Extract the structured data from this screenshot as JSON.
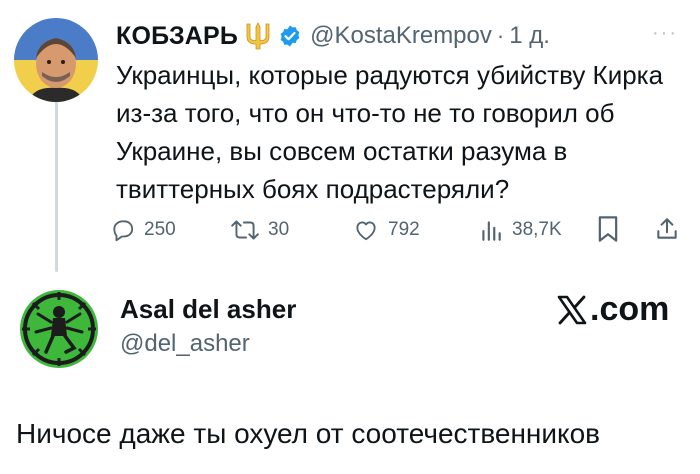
{
  "tweet": {
    "author_name": "КОБЗАРЬ",
    "handle": "@KostaKrempov",
    "separator": "·",
    "time": "1 д.",
    "more": "···",
    "text": "Украинцы, которые радуются убийству Кирка из-за того, что он что-то не то говорил об Украине, вы совсем остатки разума в твиттерных боях подрастеряли?",
    "stats": {
      "replies": "250",
      "retweets": "30",
      "likes": "792",
      "views": "38,7K"
    },
    "icons": [
      "trident-emoji",
      "verified-badge",
      "reply-icon",
      "retweet-icon",
      "like-icon",
      "views-icon",
      "bookmark-icon",
      "share-icon"
    ]
  },
  "reply_card": {
    "author_name": "Asal del asher",
    "handle": "@del_asher",
    "brand": ".com",
    "text": "Ничосе даже ты охуел от соотечественников"
  },
  "colors": {
    "secondary_text": "#536471",
    "verified_blue": "#1d9bf0",
    "trident_gold": "#f5c542",
    "avatar2_green": "#3db83a"
  }
}
